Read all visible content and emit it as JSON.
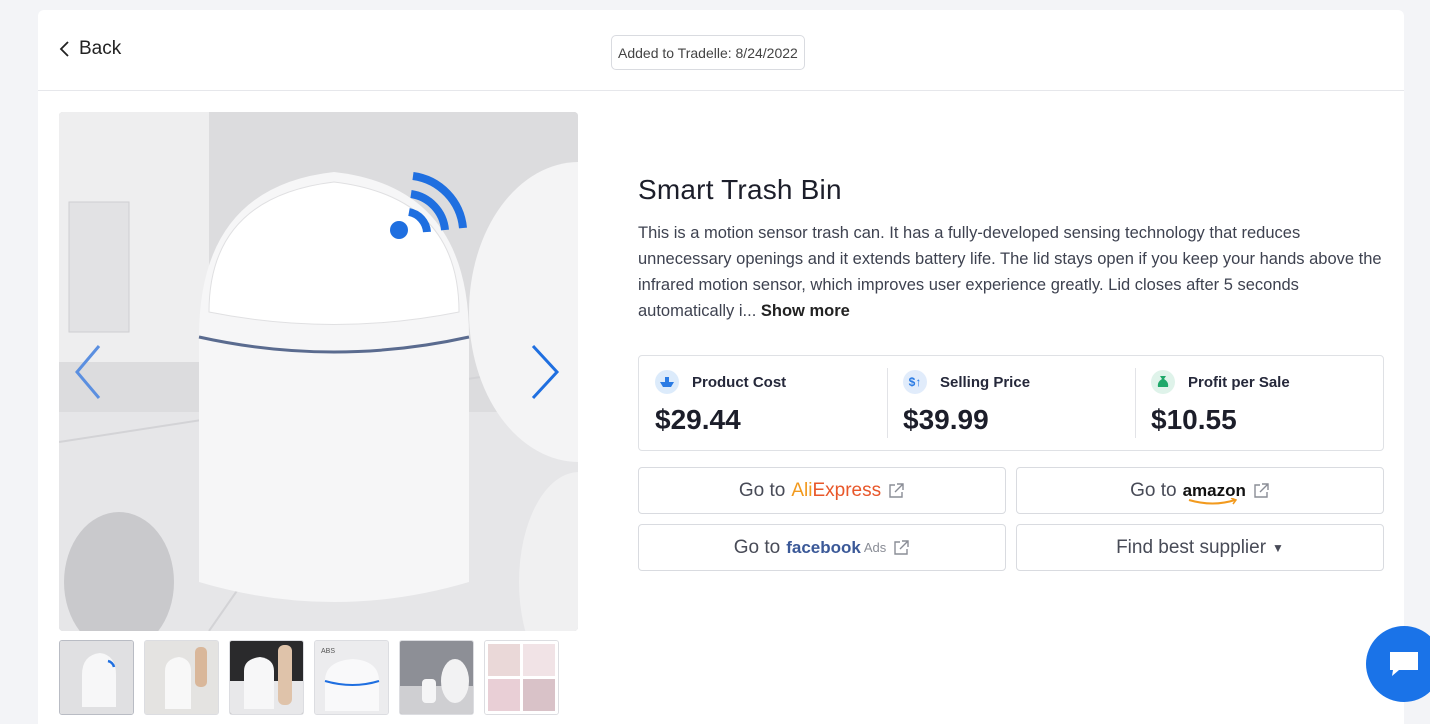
{
  "header": {
    "back_label": "Back",
    "added_label": "Added to Tradelle: 8/24/2022"
  },
  "product": {
    "title": "Smart Trash Bin",
    "description": "This is a motion sensor trash can. It has a fully-developed sensing technology that reduces unnecessary openings and it extends battery life. The lid stays open if you keep your hands above the infrared motion sensor, which improves user experience greatly. Lid closes after 5 seconds automatically i...",
    "show_more_label": "Show more"
  },
  "stats": {
    "cost": {
      "label": "Product Cost",
      "value": "$29.44"
    },
    "price": {
      "label": "Selling Price",
      "value": "$39.99"
    },
    "profit": {
      "label": "Profit per Sale",
      "value": "$10.55"
    }
  },
  "links": {
    "go_to": "Go to",
    "aliexpress_ali": "Ali",
    "aliexpress_rest": "Express",
    "amazon": "amazon",
    "facebook": "facebook",
    "facebook_ads": "Ads",
    "supplier": "Find best supplier"
  },
  "gallery": {
    "thumbnail_count": 6,
    "thumb_abs_text": "ABS"
  },
  "colors": {
    "accent_blue": "#1a73e8",
    "ali_orange": "#e8572a",
    "facebook_blue": "#3b5998"
  }
}
